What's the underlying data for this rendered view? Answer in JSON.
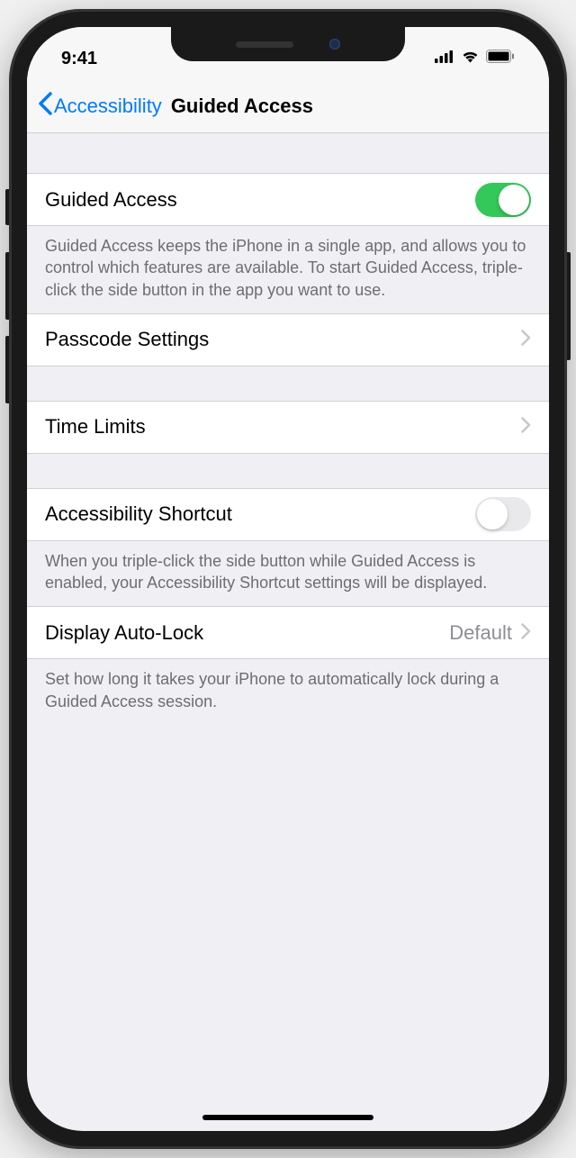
{
  "status": {
    "time": "9:41"
  },
  "nav": {
    "back_label": "Accessibility",
    "title": "Guided Access"
  },
  "sections": {
    "guided_access": {
      "label": "Guided Access",
      "enabled": true,
      "footer": "Guided Access keeps the iPhone in a single app, and allows you to control which features are available. To start Guided Access, triple-click the side button in the app you want to use."
    },
    "passcode": {
      "label": "Passcode Settings"
    },
    "time_limits": {
      "label": "Time Limits"
    },
    "accessibility_shortcut": {
      "label": "Accessibility Shortcut",
      "enabled": false,
      "footer": "When you triple-click the side button while Guided Access is enabled, your Accessibility Shortcut settings will be displayed."
    },
    "display_auto_lock": {
      "label": "Display Auto-Lock",
      "value": "Default",
      "footer": "Set how long it takes your iPhone to automatically lock during a Guided Access session."
    }
  }
}
